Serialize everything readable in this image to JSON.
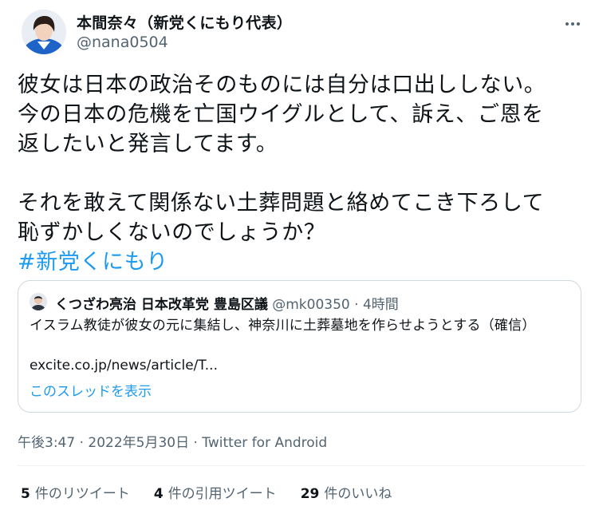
{
  "author": {
    "display_name": "本間奈々（新党くにもり代表）",
    "handle": "@nana0504",
    "avatar": "user-avatar"
  },
  "tweet": {
    "lines": [
      "彼女は日本の政治そのものには自分は口出ししない。",
      "今の日本の危機を亡国ウイグルとして、訴え、ご恩を",
      "返したいと発言してます。",
      "それを敢えて関係ない土葬問題と絡めてこき下ろして",
      "恥ずかしくないのでしょうか？"
    ],
    "hashtag": "#新党くにもり"
  },
  "quote": {
    "name": "くつざわ亮治 日本改革党 豊島区議",
    "meta": " @mk00350 · 4時間",
    "text": "イスラム教徒が彼女の元に集結し、神奈川に土葬墓地を作らせようとする（確信）",
    "link": "excite.co.jp/news/article/T...",
    "show_thread": "このスレッドを表示"
  },
  "timestamp": "午後3:47 · 2022年5月30日 · Twitter for Android",
  "stats": {
    "retweets_count": "5",
    "retweets_label": "件のリツイート",
    "quotes_count": "4",
    "quotes_label": "件の引用ツイート",
    "likes_count": "29",
    "likes_label": "件のいいね"
  },
  "colors": {
    "link": "#1d9bf0",
    "secondary_text": "#536471",
    "border": "#cfd9de"
  }
}
